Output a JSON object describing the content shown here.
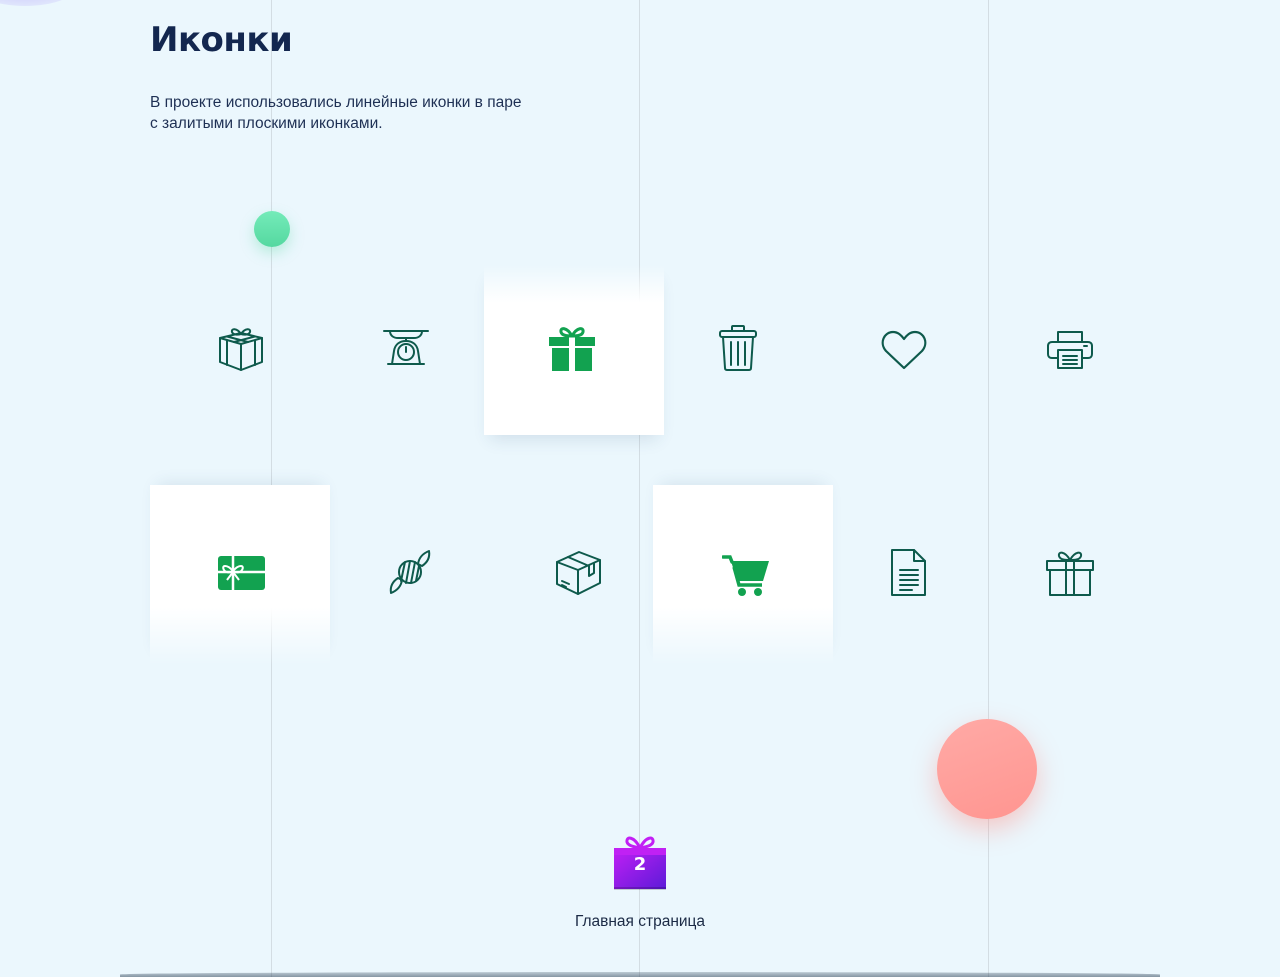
{
  "heading": {
    "title": "Иконки",
    "description": "В проекте использовались линейные иконки в паре с залитыми плоскими иконками."
  },
  "colors": {
    "background": "#ebf7fd",
    "title": "#13274f",
    "outline_icon": "#0e5a4c",
    "filled_icon": "#12a250",
    "accent_green_dot": "#5fe0a8",
    "accent_pink_dot": "#ff9d98",
    "gift_badge": "#8a1ff0"
  },
  "icons": {
    "row_1": [
      {
        "name": "gift-box-icon",
        "style": "outline"
      },
      {
        "name": "kitchen-scale-icon",
        "style": "outline"
      },
      {
        "name": "gift-icon",
        "style": "filled"
      },
      {
        "name": "trash-can-icon",
        "style": "outline"
      },
      {
        "name": "heart-icon",
        "style": "outline"
      },
      {
        "name": "printer-icon",
        "style": "outline"
      }
    ],
    "row_2": [
      {
        "name": "gift-card-icon",
        "style": "filled"
      },
      {
        "name": "candy-icon",
        "style": "outline"
      },
      {
        "name": "package-box-icon",
        "style": "outline"
      },
      {
        "name": "shopping-cart-icon",
        "style": "filled"
      },
      {
        "name": "document-icon",
        "style": "outline"
      },
      {
        "name": "gift-icon",
        "style": "outline"
      }
    ]
  },
  "footer": {
    "badge_number": "2",
    "badge_icon": "gift-icon",
    "link_label": "Главная страница"
  }
}
